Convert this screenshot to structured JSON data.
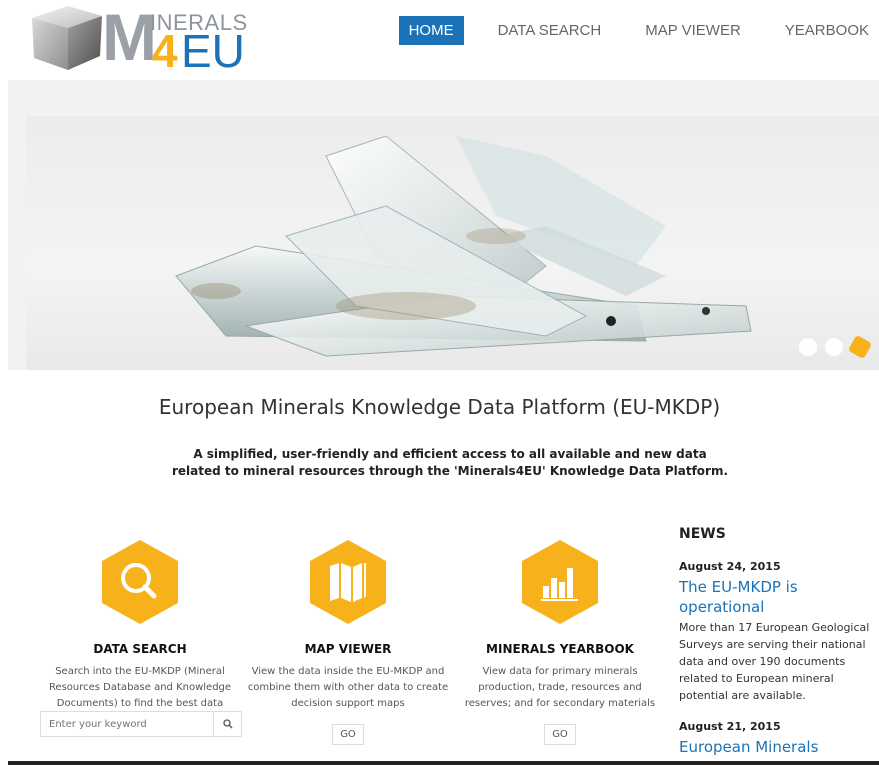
{
  "logo": {
    "m": "M",
    "inerals": "INERALS",
    "four": "4",
    "eu": "EU"
  },
  "nav": {
    "items": [
      {
        "label": "HOME",
        "active": true
      },
      {
        "label": "DATA SEARCH",
        "active": false
      },
      {
        "label": "MAP VIEWER",
        "active": false
      },
      {
        "label": "YEARBOOK",
        "active": false
      }
    ]
  },
  "slider": {
    "dot_count": 3,
    "active_dot": 3
  },
  "main": {
    "title": "European Minerals Knowledge Data Platform (EU-MKDP)",
    "subtitle": "A simplified, user-friendly and efficient access to all available and new data related to mineral resources through the 'Minerals4EU' Knowledge Data Platform."
  },
  "features": [
    {
      "title": "DATA SEARCH",
      "desc": "Search into the EU-MKDP (Mineral Resources Database and Knowledge Documents) to find the best data",
      "icon": "search-icon"
    },
    {
      "title": "MAP VIEWER",
      "desc": "View the data inside the EU-MKDP and combine them with other data to create decision support maps",
      "go": "GO",
      "icon": "map-icon"
    },
    {
      "title": "MINERALS YEARBOOK",
      "desc": "View data for primary minerals production, trade, resources and reserves; and for secondary materials",
      "go": "GO",
      "icon": "bar-chart-icon"
    }
  ],
  "search": {
    "placeholder": "Enter your keyword"
  },
  "news": {
    "heading": "NEWS",
    "items": [
      {
        "date": "August 24, 2015",
        "title": "The EU-MKDP is operational",
        "body": "More than 17 European Geological Surveys are serving their national data and over 190 documents related to European mineral potential are available."
      },
      {
        "date": "August 21, 2015",
        "title": "European Minerals"
      }
    ]
  },
  "colors": {
    "accent_yellow": "#f7b21b",
    "brand_blue": "#1a73b8"
  }
}
